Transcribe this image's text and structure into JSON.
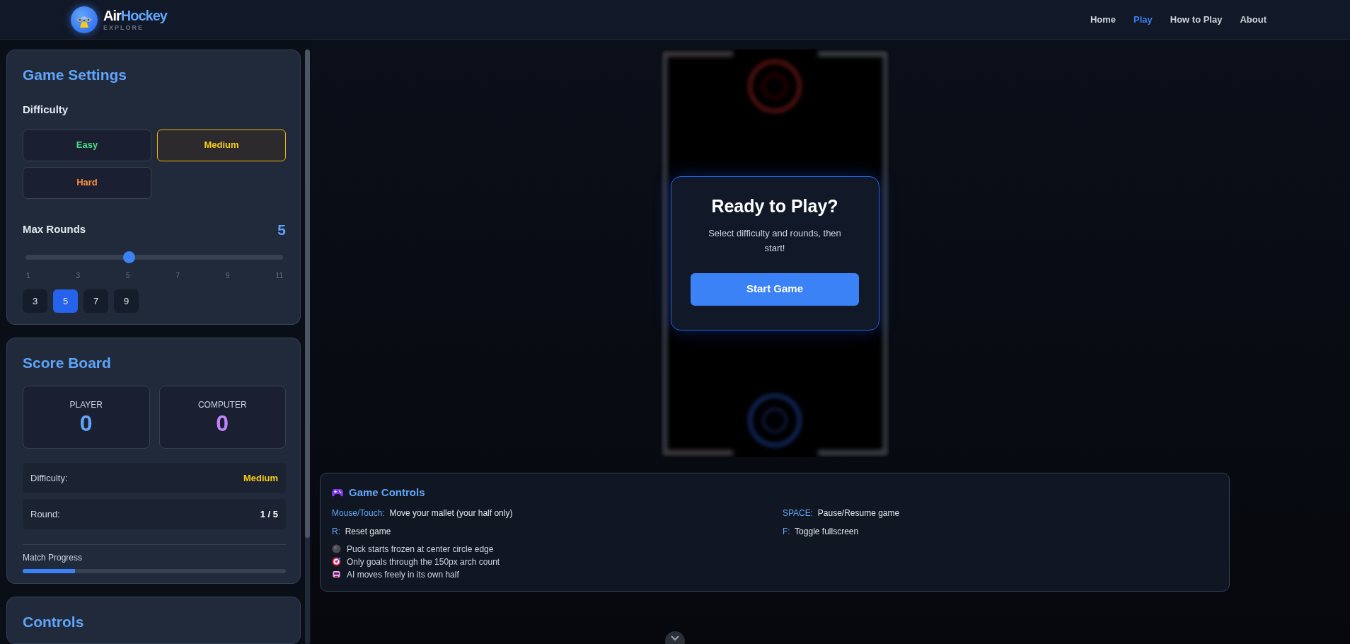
{
  "header": {
    "logo": {
      "name_parts": [
        "Air",
        "Hockey"
      ],
      "tagline": "EXPLORE"
    },
    "nav": [
      {
        "label": "Home",
        "selected": false
      },
      {
        "label": "Play",
        "selected": true
      },
      {
        "label": "How to Play",
        "selected": false
      },
      {
        "label": "About",
        "selected": false
      }
    ]
  },
  "game_settings": {
    "title": "Game Settings",
    "difficulty_label": "Difficulty",
    "difficulties": [
      {
        "label": "Easy",
        "color": "#4ade80",
        "selected": false
      },
      {
        "label": "Medium",
        "color": "#facc15",
        "selected": true
      },
      {
        "label": "Hard",
        "color": "#fb923c",
        "selected": false
      }
    ],
    "max_rounds_label": "Max Rounds",
    "max_rounds_value": "5",
    "slider": {
      "level": 0.4,
      "ticks": [
        "1",
        "3",
        "5",
        "7",
        "9",
        "11"
      ]
    },
    "presets": [
      {
        "label": "3",
        "selected": false
      },
      {
        "label": "5",
        "selected": true
      },
      {
        "label": "7",
        "selected": false
      },
      {
        "label": "9",
        "selected": false
      }
    ]
  },
  "score_board": {
    "title": "Score Board",
    "scores": [
      {
        "label": "PLAYER",
        "value": "0",
        "color": "#60a5fa"
      },
      {
        "label": "COMPUTER",
        "value": "0",
        "color": "#c084fc"
      }
    ],
    "info": [
      {
        "label": "Difficulty:",
        "value": "Medium",
        "color": "#facc15"
      },
      {
        "label": "Round:",
        "value": "1 / 5",
        "color": "#ffffff"
      }
    ],
    "progress": {
      "label": "Match Progress",
      "level": 0.2
    }
  },
  "controls_panel": {
    "title": "Controls"
  },
  "overlay": {
    "title": "Ready to Play?",
    "message": "Select difficulty and rounds, then start!",
    "button": "Start Game"
  },
  "game_controls": {
    "title": "Game Controls",
    "bindings": [
      {
        "key": "Mouse/Touch:",
        "action": "Move your mallet (your half only)"
      },
      {
        "key": "SPACE:",
        "action": "Pause/Resume game"
      },
      {
        "key": "R:",
        "action": "Reset game"
      },
      {
        "key": "F:",
        "action": "Toggle fullscreen"
      }
    ],
    "tips": [
      "Puck starts frozen at center circle edge",
      "Only goals through the 150px arch count",
      "AI moves freely in its own half"
    ]
  }
}
